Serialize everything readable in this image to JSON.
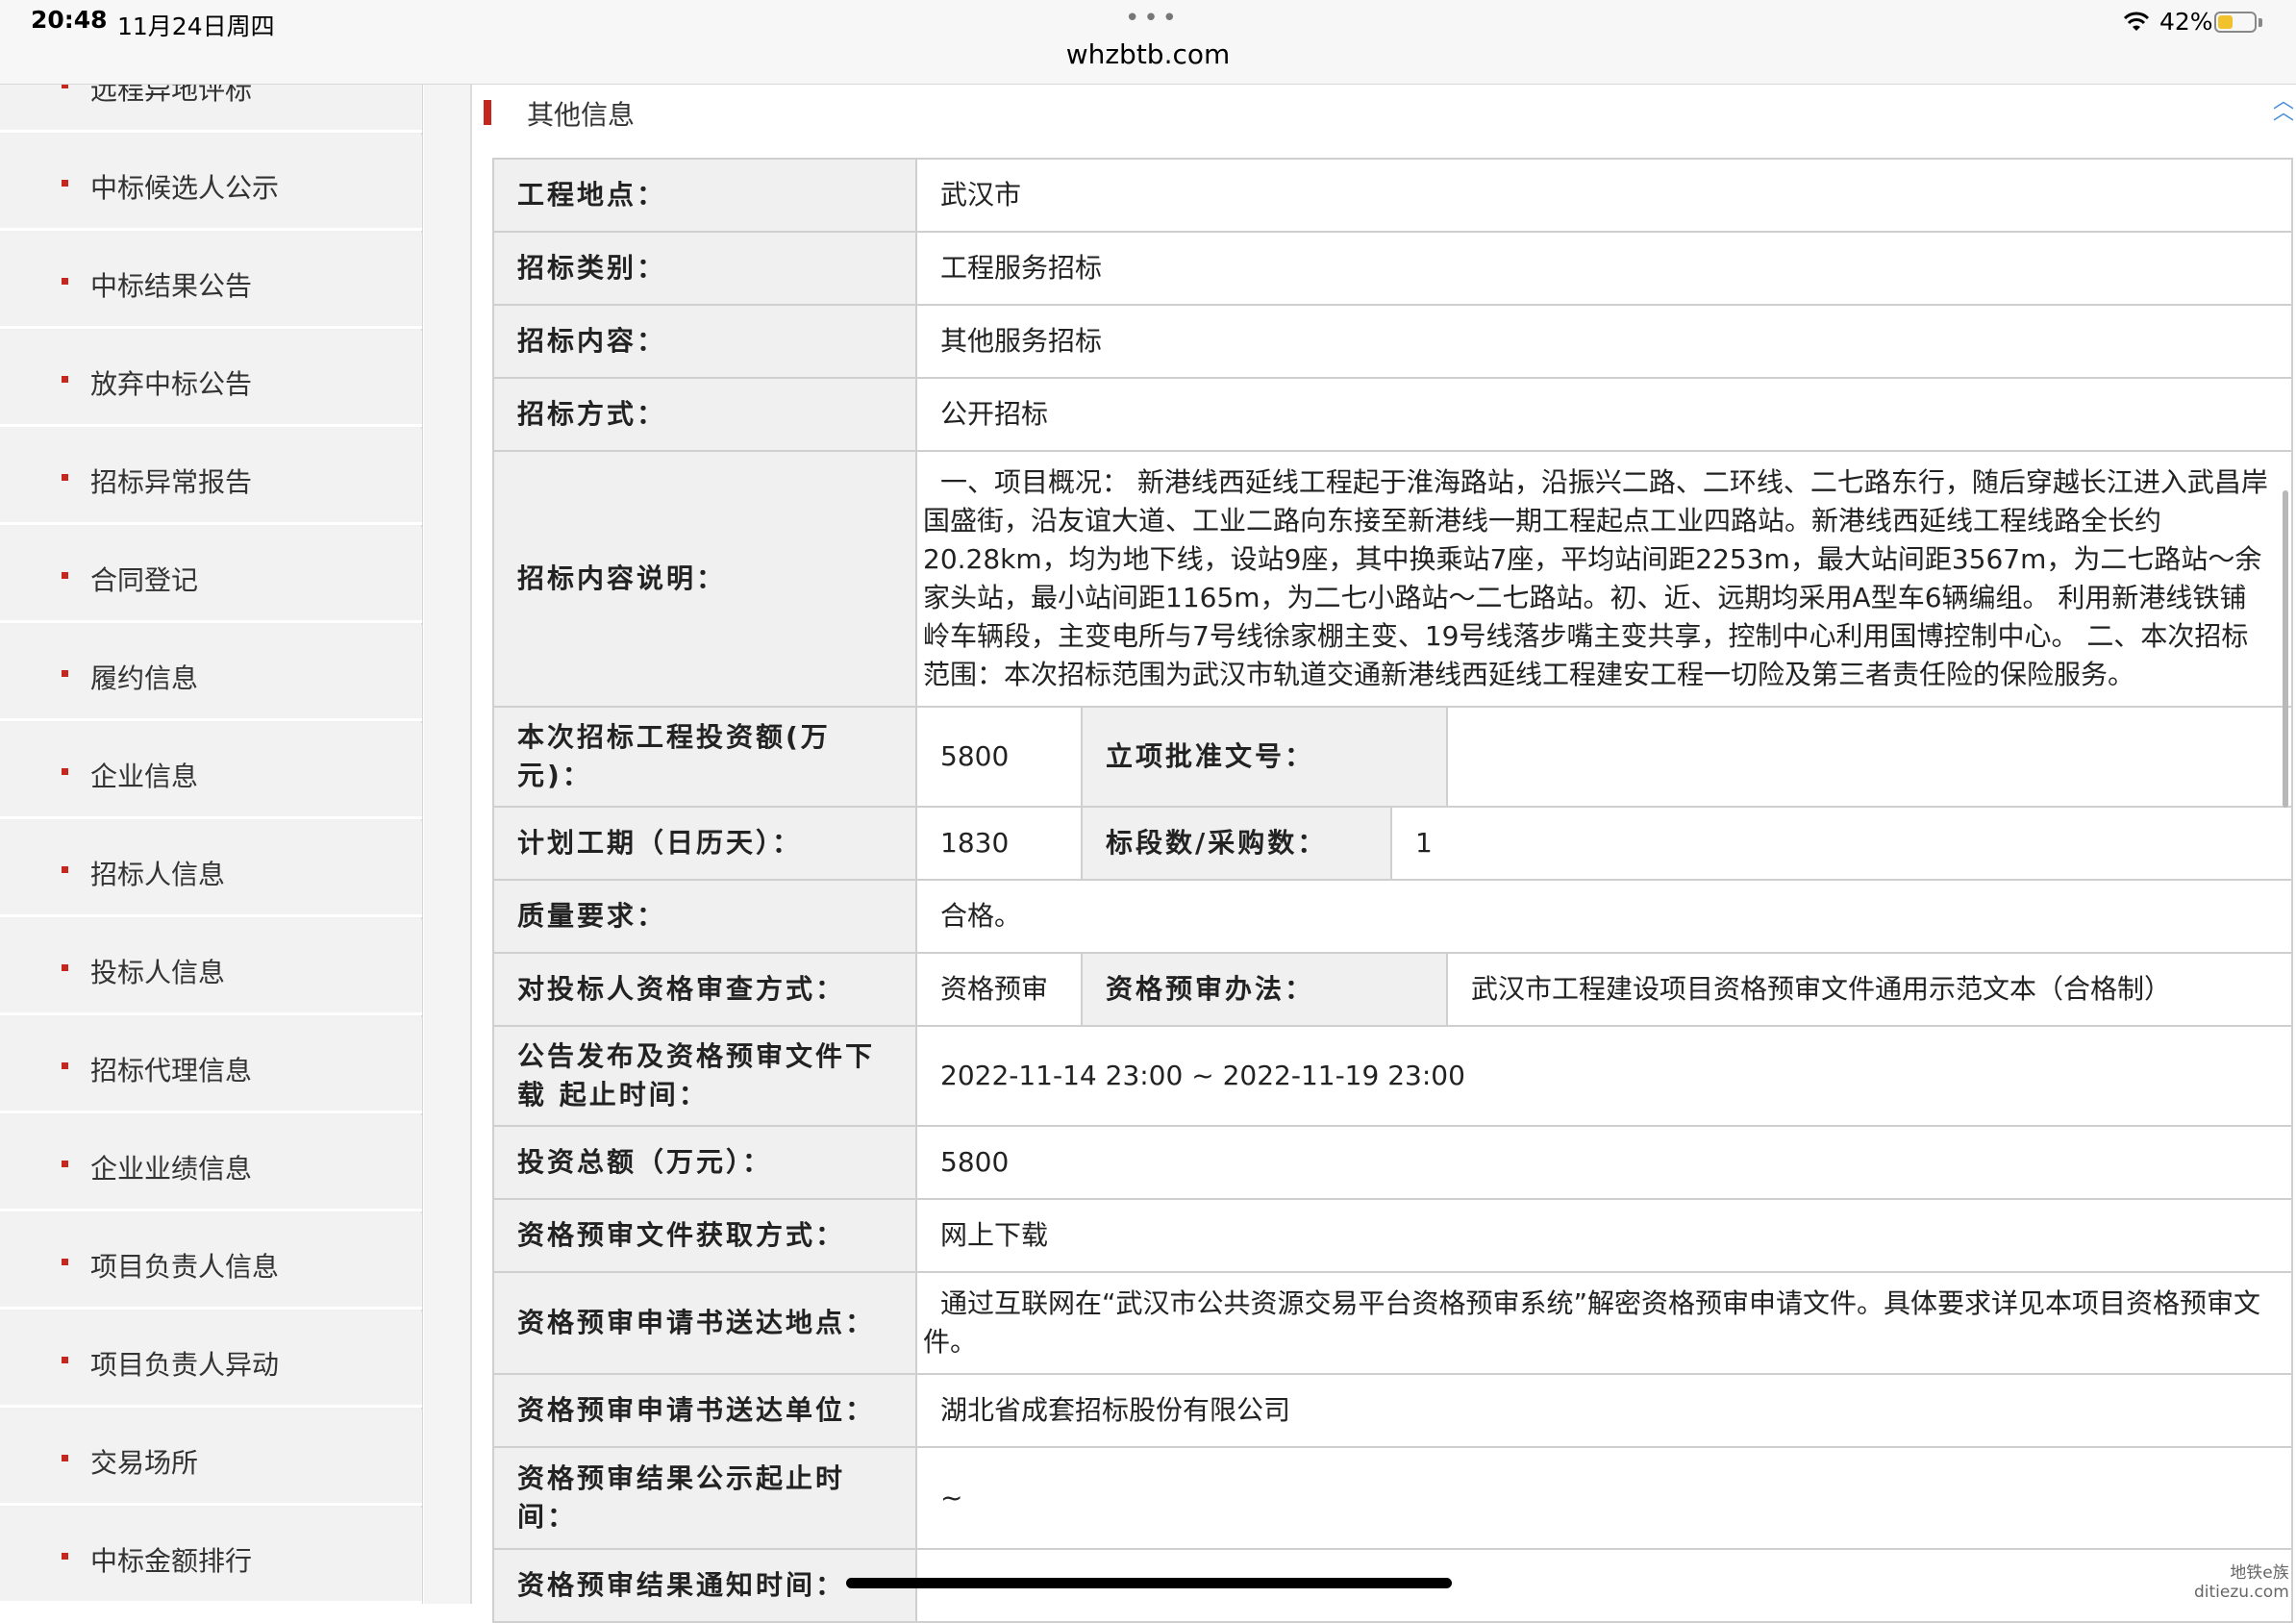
{
  "status_bar": {
    "time": "20:48",
    "date": "11月24日周四",
    "url": "whzbtb.com",
    "battery_pct": "42%",
    "battery_level": 0.42
  },
  "sidebar": {
    "items": [
      {
        "label": "远程异地评标"
      },
      {
        "label": "中标候选人公示"
      },
      {
        "label": "中标结果公告"
      },
      {
        "label": "放弃中标公告"
      },
      {
        "label": "招标异常报告"
      },
      {
        "label": "合同登记"
      },
      {
        "label": "履约信息"
      },
      {
        "label": "企业信息"
      },
      {
        "label": "招标人信息"
      },
      {
        "label": "投标人信息"
      },
      {
        "label": "招标代理信息"
      },
      {
        "label": "企业业绩信息"
      },
      {
        "label": "项目负责人信息"
      },
      {
        "label": "项目负责人异动"
      },
      {
        "label": "交易场所"
      },
      {
        "label": "中标金额排行"
      }
    ]
  },
  "section": {
    "title": "其他信息",
    "collapse_icon": "double-chevron-up-icon"
  },
  "table": {
    "location": {
      "label": "工程地点：",
      "value": "武汉市"
    },
    "category": {
      "label": "招标类别：",
      "value": "工程服务招标"
    },
    "content": {
      "label": "招标内容：",
      "value": "其他服务招标"
    },
    "method": {
      "label": "招标方式：",
      "value": "公开招标"
    },
    "description": {
      "label": "招标内容说明：",
      "value": "一、项目概况：  新港线西延线工程起于淮海路站，沿振兴二路、二环线、二七路东行，随后穿越长江进入武昌岸国盛街，沿友谊大道、工业二路向东接至新港线一期工程起点工业四路站。新港线西延线工程线路全长约20.28km，均为地下线，设站9座，其中换乘站7座，平均站间距2253m，最大站间距3567m，为二七路站～余家头站，最小站间距1165m，为二七小路站～二七路站。初、近、远期均采用A型车6辆编组。 利用新港线铁铺岭车辆段，主变电所与7号线徐家棚主变、19号线落步嘴主变共享，控制中心利用国博控制中心。 二、本次招标范围：本次招标范围为武汉市轨道交通新港线西延线工程建安工程一切险及第三者责任险的保险服务。"
    },
    "investment": {
      "label": "本次招标工程投资额(万元)：",
      "value": "5800"
    },
    "approval": {
      "label": "立项批准文号：",
      "value": ""
    },
    "period": {
      "label": "计划工期（日历天）：",
      "value": "1830"
    },
    "sections": {
      "label": "标段数/采购数：",
      "value": "1"
    },
    "quality": {
      "label": "质量要求：",
      "value": "合格。"
    },
    "review": {
      "label": "对投标人资格审查方式：",
      "value": "资格预审"
    },
    "review_method": {
      "label": "资格预审办法：",
      "value": "武汉市工程建设项目资格预审文件通用示范文本（合格制）"
    },
    "announce_time": {
      "label": "公告发布及资格预审文件下载 起止时间：",
      "value": "2022-11-14 23:00 ~ 2022-11-19 23:00"
    },
    "total_investment": {
      "label": "投资总额（万元）：",
      "value": "5800"
    },
    "obtain": {
      "label": "资格预审文件获取方式：",
      "value": "网上下载"
    },
    "submit_place": {
      "label": "资格预审申请书送达地点：",
      "value": "通过互联网在“武汉市公共资源交易平台资格预审系统”解密资格预审申请文件。具体要求详见本项目资格预审文件。"
    },
    "submit_unit": {
      "label": "资格预审申请书送达单位：",
      "value": "湖北省成套招标股份有限公司"
    },
    "result_time": {
      "label": "资格预审结果公示起止时间：",
      "value": "~"
    },
    "notify_time": {
      "label": "资格预审结果通知时间：",
      "value": ""
    }
  },
  "watermark": {
    "line1": "地铁e族",
    "line2": "ditiezu.com"
  }
}
